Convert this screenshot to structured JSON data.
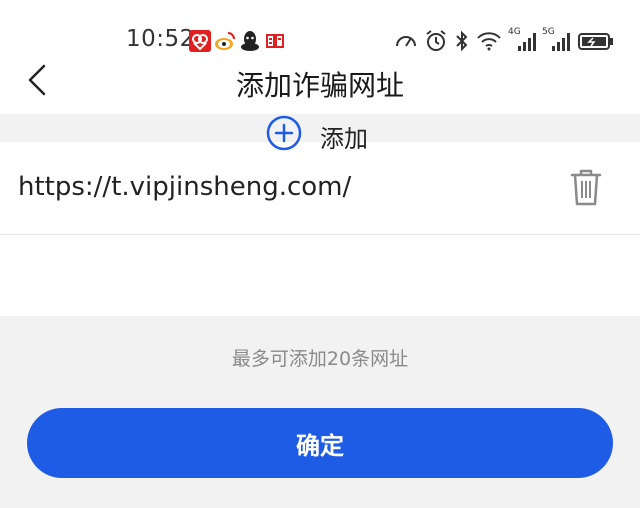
{
  "status_bar": {
    "time": "10:52",
    "network_labels": {
      "first": "4G",
      "second": "5G"
    }
  },
  "header": {
    "title": "添加诈骗网址"
  },
  "url_list": {
    "items": [
      {
        "url": "https://t.vipjinsheng.com/"
      }
    ],
    "add_label": "添加"
  },
  "hint": "最多可添加20条网址",
  "confirm_label": "确定",
  "colors": {
    "accent": "#1f5ce6",
    "background": "#f2f2f2",
    "card": "#ffffff",
    "hint_text": "#8a8a8a"
  },
  "icons": {
    "back": "chevron-left-icon",
    "delete": "trash-icon",
    "add": "plus-circle-icon"
  }
}
